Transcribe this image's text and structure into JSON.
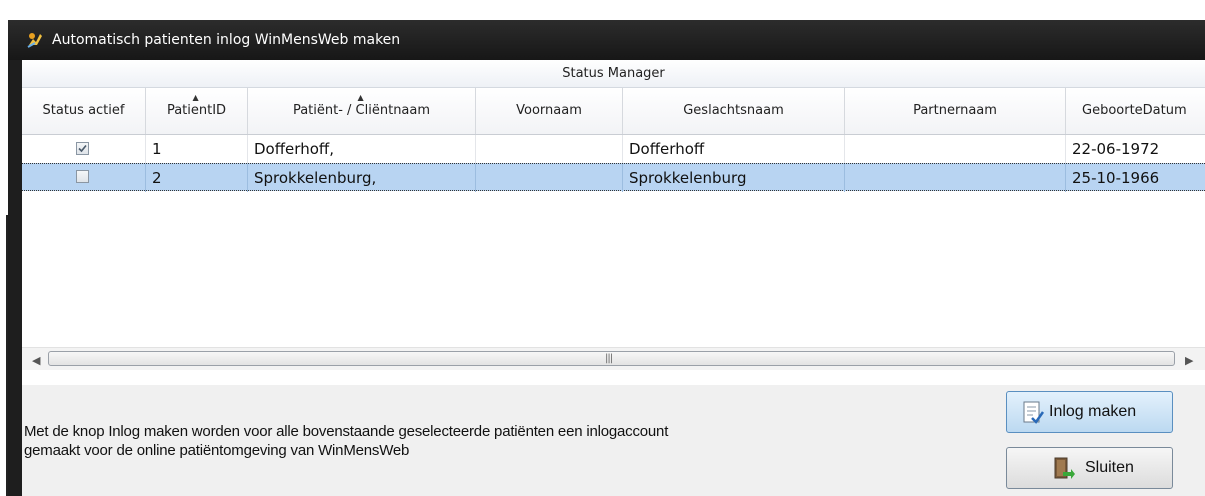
{
  "window": {
    "title": "Automatisch patienten inlog WinMensWeb maken",
    "icon": "app-icon"
  },
  "grid": {
    "caption": "Status Manager",
    "columns": [
      {
        "label": "Status actief",
        "sorted": false
      },
      {
        "label": "PatientID",
        "sorted": true
      },
      {
        "label": "Patiënt- / Cliëntnaam",
        "sorted": true
      },
      {
        "label": "Voornaam",
        "sorted": false
      },
      {
        "label": "Geslachtsnaam",
        "sorted": false
      },
      {
        "label": "Partnernaam",
        "sorted": false
      },
      {
        "label": "GeboorteDatum",
        "sorted": false
      }
    ],
    "rows": [
      {
        "active": true,
        "id": "1",
        "name": "Dofferhoff,",
        "firstname": "",
        "surname": "Dofferhoff",
        "partner": "",
        "birthdate": "22-06-1972",
        "selected": false
      },
      {
        "active": false,
        "id": "2",
        "name": "Sprokkelenburg,",
        "firstname": "",
        "surname": "Sprokkelenburg",
        "partner": "",
        "birthdate": "25-10-1966",
        "selected": true
      }
    ]
  },
  "info_text": {
    "line1": "Met de knop Inlog maken worden voor alle bovenstaande geselecteerde patiënten een inlogaccount",
    "line2": "gemaakt voor de online patiëntomgeving van WinMensWeb"
  },
  "buttons": {
    "login_label": "Inlog maken",
    "close_label": "Sluiten"
  },
  "colors": {
    "selected_row": "#b8d4f2",
    "titlebar": "#1e1e1e"
  }
}
